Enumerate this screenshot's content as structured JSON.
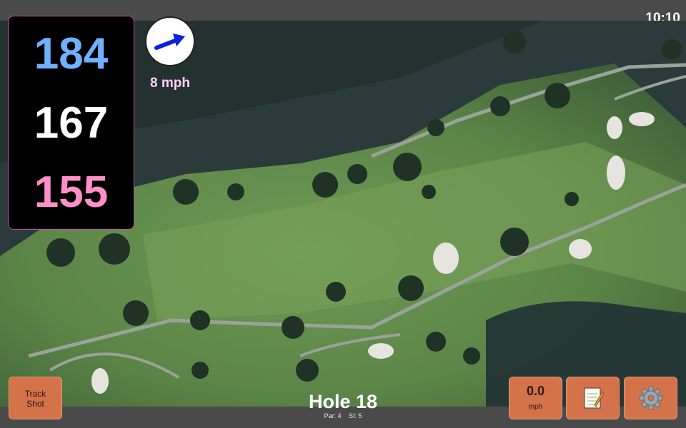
{
  "status": {
    "time": "10:10"
  },
  "distances": {
    "back": "184",
    "middle": "167",
    "front": "155"
  },
  "colors": {
    "back": "#6fb1ff",
    "middle": "#ffffff",
    "front": "#ff8fc8",
    "wind_arrow": "#0a1fe0",
    "button": "#d4724a"
  },
  "wind": {
    "speed": "8 mph",
    "icon": "wind-direction-arrow-icon"
  },
  "buttons": {
    "track_shot": {
      "line1": "Track",
      "line2": "Shot"
    },
    "speed": {
      "value": "0.0",
      "unit": "mph"
    },
    "notes_icon": "notepad-icon",
    "settings_icon": "gear-icon"
  },
  "hole": {
    "title": "Hole 18",
    "par": "Par: 4",
    "si": "SI: 5"
  }
}
